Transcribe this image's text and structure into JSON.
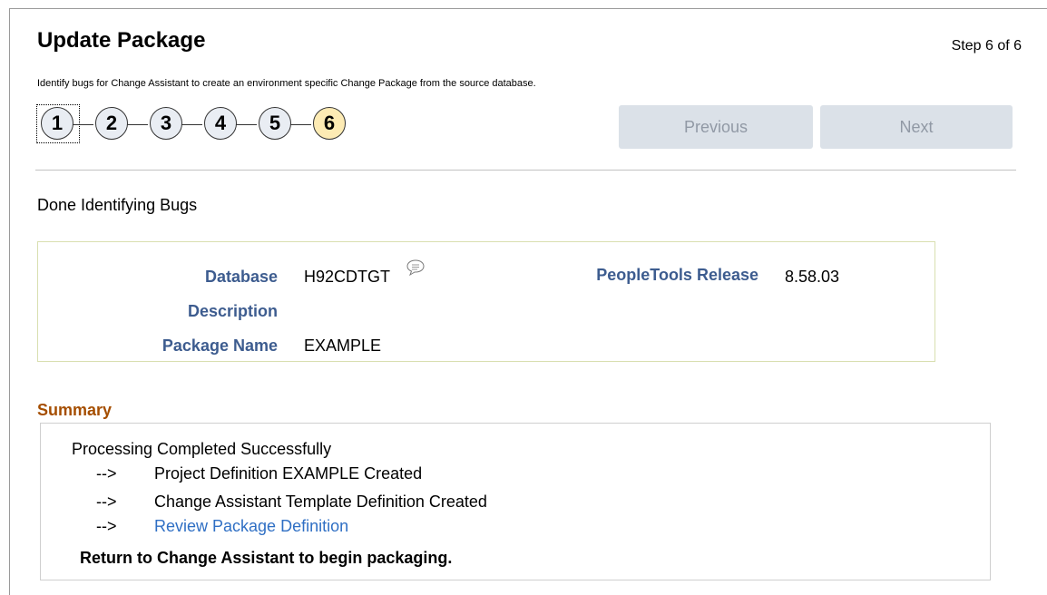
{
  "page": {
    "title": "Update Package",
    "step_indicator": "Step 6 of 6",
    "instructions": "Identify bugs for Change Assistant to create an environment specific Change Package from the source database."
  },
  "train": {
    "steps": [
      "1",
      "2",
      "3",
      "4",
      "5",
      "6"
    ],
    "current_step": 6
  },
  "navigation": {
    "previous_label": "Previous",
    "next_label": "Next"
  },
  "status": "Done Identifying Bugs",
  "info": {
    "database_label": "Database",
    "database_value": "H92CDTGT",
    "description_label": "Description",
    "description_value": "",
    "package_name_label": "Package Name",
    "package_name_value": "EXAMPLE",
    "peopletools_label": "PeopleTools Release",
    "peopletools_value": "8.58.03"
  },
  "summary": {
    "title": "Summary",
    "processing": "Processing Completed Successfully",
    "arrow": "-->",
    "lines": [
      "Project Definition EXAMPLE Created",
      "Change Assistant Template Definition Created"
    ],
    "link_label": "Review Package Definition",
    "final": "Return to Change Assistant to begin packaging."
  },
  "colors": {
    "label_blue": "#3d5c8f",
    "summary_orange": "#a54e00",
    "link_blue": "#2f6fc4",
    "current_step_fill": "#fdebb4",
    "step_fill": "#e9edf3",
    "button_disabled_bg": "#dbe1e8"
  }
}
